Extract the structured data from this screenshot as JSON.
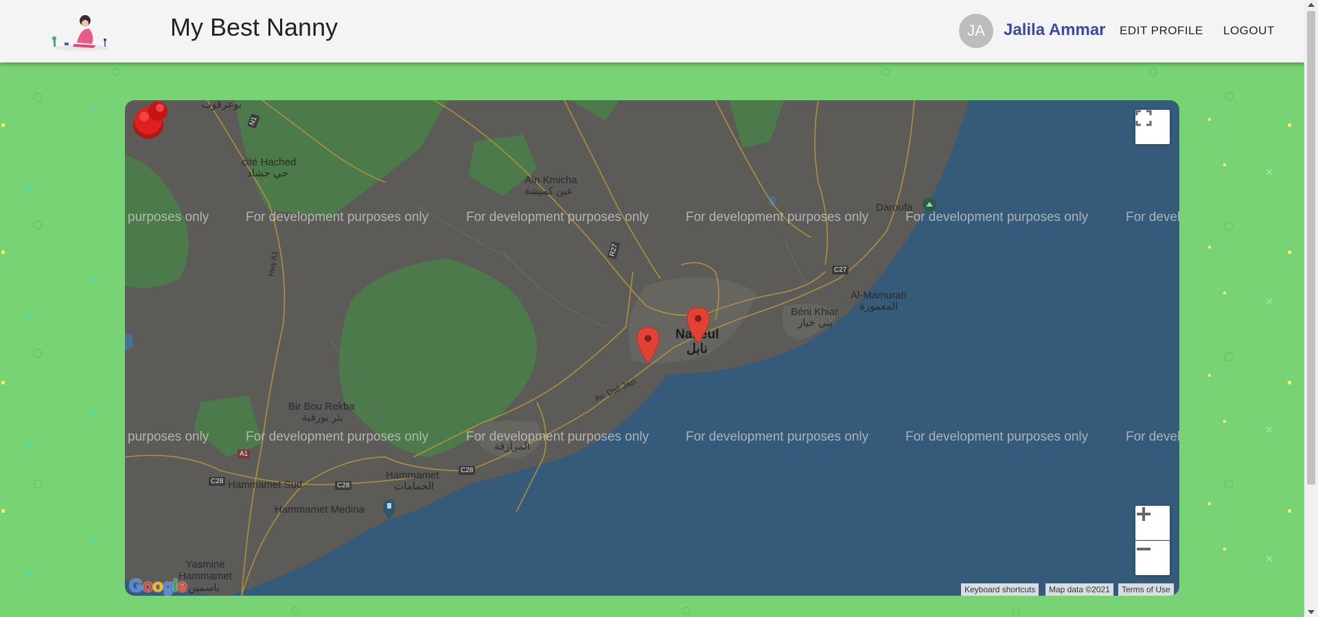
{
  "header": {
    "site_title": "My Best Nanny",
    "user": {
      "initials": "JA",
      "name": "Jalila Ammar"
    },
    "nav": {
      "edit_profile": "EDIT PROFILE",
      "logout": "LOGOUT"
    }
  },
  "map": {
    "labels": {
      "bou_argoub": "بوعرقوب",
      "cite_hached": "cité Hached",
      "cite_hached_ar": "حي حشاد",
      "ain_kmicha": "Aïn Kmicha",
      "ain_kmicha_ar": "عين كميشة",
      "daroufa": "Daroufa",
      "al_mamurah": "Al-Mamurah",
      "al_mamurah_ar": "المعمورة",
      "beni_khiar": "Béni Khiar",
      "beni_khiar_ar": "بني خيار",
      "nabeul": "Nabeul",
      "nabeul_ar": "نابل",
      "bir_bou_rekba": "Bir Bou Rekba",
      "bir_bou_rekba_ar": "بئر بورقبة",
      "mrazka_ar": "المرازقة",
      "hammamet_sud": "Hammamet Sud",
      "hammamet": "Hammamet",
      "hammamet_ar": "الحمامات",
      "hammamet_medina": "Hammamet Medina",
      "yasmine": "Yasmine Hammamet",
      "yasmine_ar": "ياسمين",
      "av_dali_jazi": "Av. Dali Jazi",
      "hwy_a1": "Hwy A1"
    },
    "shields": {
      "a1": "A1",
      "c28a": "C28",
      "c28b": "C28",
      "c28c": "C28",
      "c27": "C27",
      "r27": "R27",
      "n1": "N1"
    },
    "watermark": "For development purposes only",
    "watermark_partial_left": "purposes only",
    "watermark_partial_right": "For devel",
    "attribution": {
      "keyboard": "Keyboard shortcuts",
      "map_data": "Map data ©2021",
      "terms": "Terms of Use"
    },
    "google_logo": "Google",
    "markers_count": 2
  },
  "colors": {
    "page_bg": "#77d373",
    "header_bg": "#f4f4f4",
    "user_name": "#3a4aa3",
    "sea": "#355a7a",
    "land": "#5c5b58",
    "park": "#4d7a4a",
    "road": "#b9963a",
    "marker": "#e04335"
  }
}
